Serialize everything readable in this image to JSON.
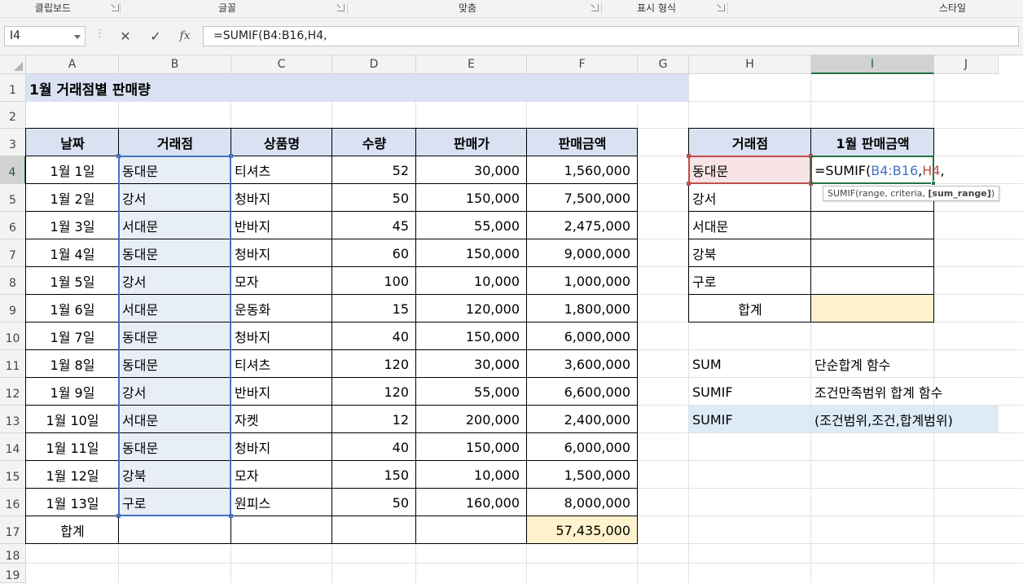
{
  "ribbon": {
    "groups": [
      "클립보드",
      "글꼴",
      "맞춤",
      "표시 형식",
      "스타일"
    ]
  },
  "formula_bar": {
    "name_box": "I4",
    "cancel_icon": "✕",
    "enter_icon": "✓",
    "fx_icon": "fx",
    "formula": "=SUMIF(B4:B16,H4,"
  },
  "columns": [
    "A",
    "B",
    "C",
    "D",
    "E",
    "F",
    "G",
    "H",
    "I",
    "J"
  ],
  "rows": [
    "1",
    "2",
    "3",
    "4",
    "5",
    "6",
    "7",
    "8",
    "9",
    "10",
    "11",
    "12",
    "13",
    "14",
    "15",
    "16",
    "17",
    "18",
    "19"
  ],
  "sheet": {
    "title": "1월 거래점별 판매량",
    "headers": [
      "날짜",
      "거래점",
      "상품명",
      "수량",
      "판매가",
      "판매금액"
    ],
    "data": [
      [
        "1월 1일",
        "동대문",
        "티셔츠",
        "52",
        "30,000",
        "1,560,000"
      ],
      [
        "1월 2일",
        "강서",
        "청바지",
        "50",
        "150,000",
        "7,500,000"
      ],
      [
        "1월 3일",
        "서대문",
        "반바지",
        "45",
        "55,000",
        "2,475,000"
      ],
      [
        "1월 4일",
        "동대문",
        "청바지",
        "60",
        "150,000",
        "9,000,000"
      ],
      [
        "1월 5일",
        "강서",
        "모자",
        "100",
        "10,000",
        "1,000,000"
      ],
      [
        "1월 6일",
        "서대문",
        "운동화",
        "15",
        "120,000",
        "1,800,000"
      ],
      [
        "1월 7일",
        "동대문",
        "청바지",
        "40",
        "150,000",
        "6,000,000"
      ],
      [
        "1월 8일",
        "동대문",
        "티셔츠",
        "120",
        "30,000",
        "3,600,000"
      ],
      [
        "1월 9일",
        "강서",
        "반바지",
        "120",
        "55,000",
        "6,600,000"
      ],
      [
        "1월 10일",
        "서대문",
        "자켓",
        "12",
        "200,000",
        "2,400,000"
      ],
      [
        "1월 11일",
        "동대문",
        "청바지",
        "40",
        "150,000",
        "6,000,000"
      ],
      [
        "1월 12일",
        "강북",
        "모자",
        "150",
        "10,000",
        "1,500,000"
      ],
      [
        "1월 13일",
        "구로",
        "원피스",
        "50",
        "160,000",
        "8,000,000"
      ]
    ],
    "total_label": "합계",
    "total_value": "57,435,000"
  },
  "summary": {
    "headers": [
      "거래점",
      "1월 판매금액"
    ],
    "branches": [
      "동대문",
      "강서",
      "서대문",
      "강북",
      "구로"
    ],
    "total_label": "합계",
    "editing_formula": {
      "prefix": "=SUMIF(",
      "range": "B4:B16",
      "sep1": ",",
      "criteria": "H4",
      "sep2": ","
    },
    "tooltip": {
      "text": "SUMIF(range, criteria, ",
      "bold": "[sum_range]",
      "close": ")"
    }
  },
  "notes": [
    [
      "SUM",
      "단순합계 함수"
    ],
    [
      "SUMIF",
      "조건만족범위 합계 함수"
    ],
    [
      "SUMIF",
      "(조건범위,조건,합계범위)"
    ]
  ],
  "colors": {
    "title_fill": "#d9e1f2",
    "header_fill": "#d9e1f2",
    "total_fill": "#fff2cc",
    "selection_fill": "#e8eef8",
    "selection_border": "#4472c4",
    "criteria_fill": "#f8e4e4",
    "criteria_border": "#c0504d",
    "active_border": "#217346",
    "note_fill": "#ddebf7"
  }
}
